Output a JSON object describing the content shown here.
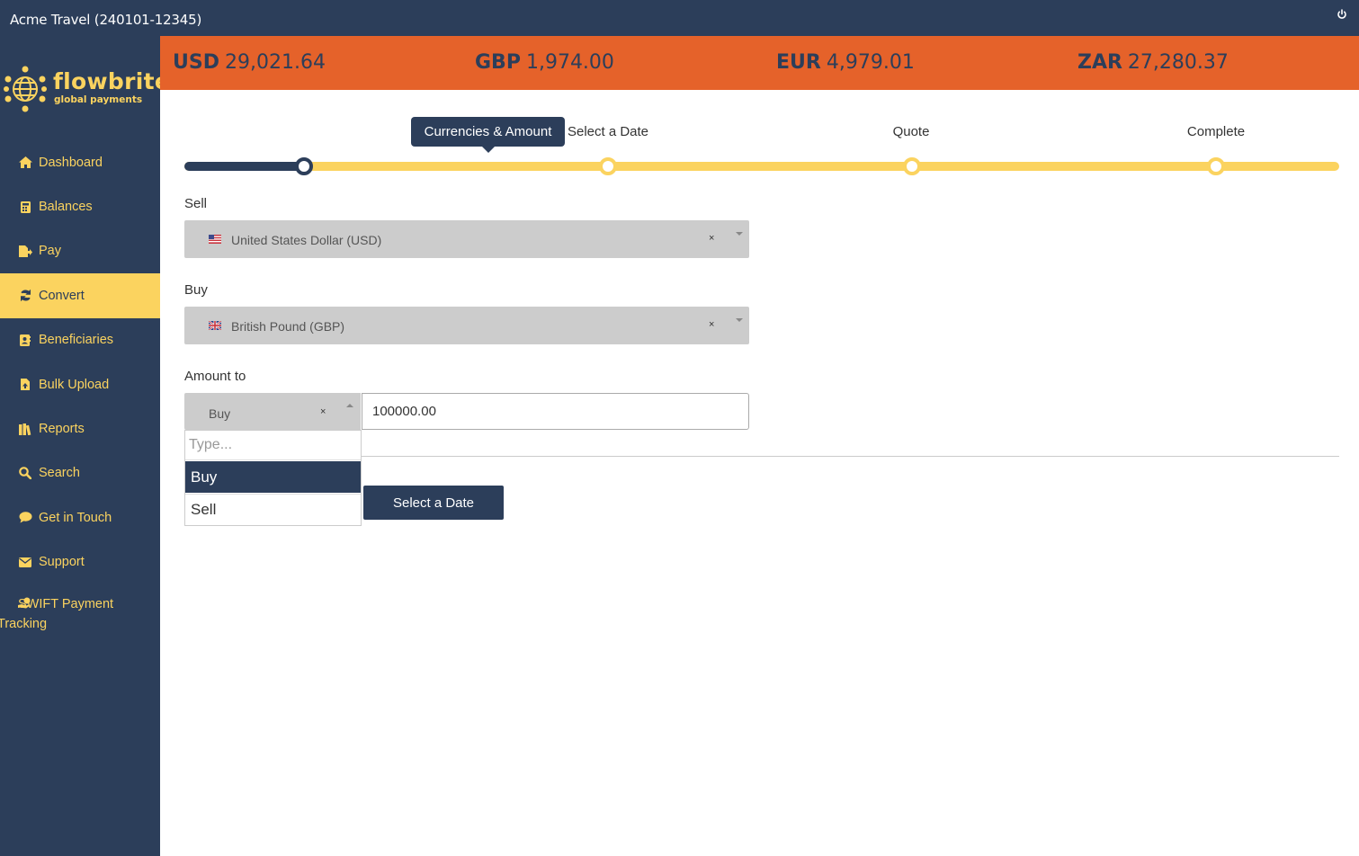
{
  "window": {
    "title": "Acme Travel (240101-12345)"
  },
  "brand": {
    "name": "flowbrite",
    "tagline": "global payments",
    "color": "#fbd35f"
  },
  "theme": {
    "navy": "#2c3e5a",
    "orange": "#e5622a",
    "yellow": "#fbd35f"
  },
  "balances": [
    {
      "currency": "USD",
      "amount": "29,021.64"
    },
    {
      "currency": "GBP",
      "amount": "1,974.00"
    },
    {
      "currency": "EUR",
      "amount": "4,979.01"
    },
    {
      "currency": "ZAR",
      "amount": "27,280.37"
    }
  ],
  "sidebar": {
    "items": [
      {
        "label": "Dashboard",
        "icon": "home-icon"
      },
      {
        "label": "Balances",
        "icon": "calculator-icon"
      },
      {
        "label": "Pay",
        "icon": "file-export-icon"
      },
      {
        "label": "Convert",
        "icon": "sync-icon",
        "active": true
      },
      {
        "label": "Beneficiaries",
        "icon": "address-book-icon"
      },
      {
        "label": "Bulk Upload",
        "icon": "file-upload-icon"
      },
      {
        "label": "Reports",
        "icon": "books-icon"
      },
      {
        "label": "Search",
        "icon": "search-icon"
      },
      {
        "label": "Get in Touch",
        "icon": "comment-icon"
      },
      {
        "label": "Support",
        "icon": "envelope-icon"
      },
      {
        "label": "SWIFT Payment Tracking",
        "icon": "hand-holding-dollar-icon"
      }
    ]
  },
  "wizard": {
    "steps": [
      "Currencies & Amount",
      "Select a Date",
      "Quote",
      "Complete"
    ],
    "current_step": 1
  },
  "form": {
    "sell": {
      "label": "Sell",
      "value": "United States Dollar (USD)",
      "clear": "×"
    },
    "buy": {
      "label": "Buy",
      "value": "British Pound (GBP)",
      "clear": "×"
    },
    "amount": {
      "label": "Amount to",
      "direction_value": "Buy",
      "clear": "×",
      "value": "100000.00",
      "dropdown": {
        "search_placeholder": "Type...",
        "options": [
          "Buy",
          "Sell"
        ],
        "selected": "Buy"
      }
    },
    "next_button": "Select a Date"
  }
}
